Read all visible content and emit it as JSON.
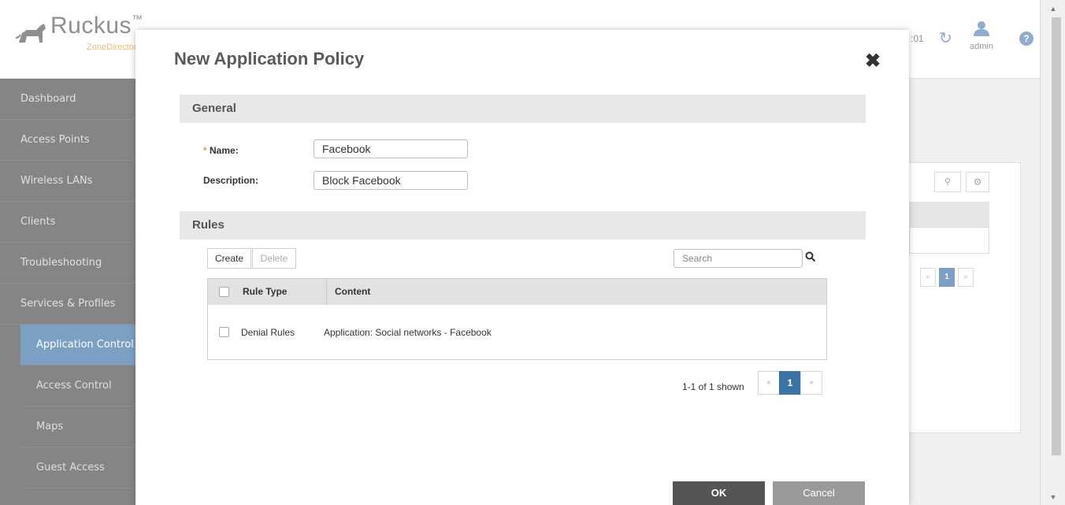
{
  "app": {
    "brand": "Ruckus",
    "brand_tm": "™",
    "brand_sub": "ZoneDirector",
    "header": {
      "time_fragment": ":01",
      "user": "admin",
      "help_symbol": "?"
    },
    "sidebar": {
      "items": [
        {
          "label": "Dashboard"
        },
        {
          "label": "Access Points"
        },
        {
          "label": "Wireless LANs"
        },
        {
          "label": "Clients"
        },
        {
          "label": "Troubleshooting"
        },
        {
          "label": "Services & Profiles"
        }
      ],
      "subitems": [
        {
          "label": "Application Control",
          "active": true
        },
        {
          "label": "Access Control"
        },
        {
          "label": "Maps"
        },
        {
          "label": "Guest Access"
        }
      ]
    },
    "background_pager": {
      "prev": "«",
      "page": "1",
      "next": "»"
    }
  },
  "modal": {
    "title": "New Application Policy",
    "close_symbol": "✖",
    "general": {
      "heading": "General",
      "name_required_mark": "*",
      "name_label": "Name:",
      "name_value": "Facebook",
      "description_label": "Description:",
      "description_value": "Block Facebook"
    },
    "rules": {
      "heading": "Rules",
      "create_label": "Create",
      "delete_label": "Delete",
      "search_placeholder": "Search",
      "columns": [
        "Rule Type",
        "Content"
      ],
      "rows": [
        {
          "rule_type": "Denial Rules",
          "content": "Application: Social networks - Facebook"
        }
      ],
      "pager_info": "1-1 of 1 shown",
      "pager": {
        "prev": "«",
        "page": "1",
        "next": "»"
      }
    },
    "ok_label": "OK",
    "cancel_label": "Cancel"
  },
  "colors": {
    "accent": "#3d74a8",
    "brand_orange": "#f39c2b",
    "sidebar": "#4c4c4c"
  }
}
